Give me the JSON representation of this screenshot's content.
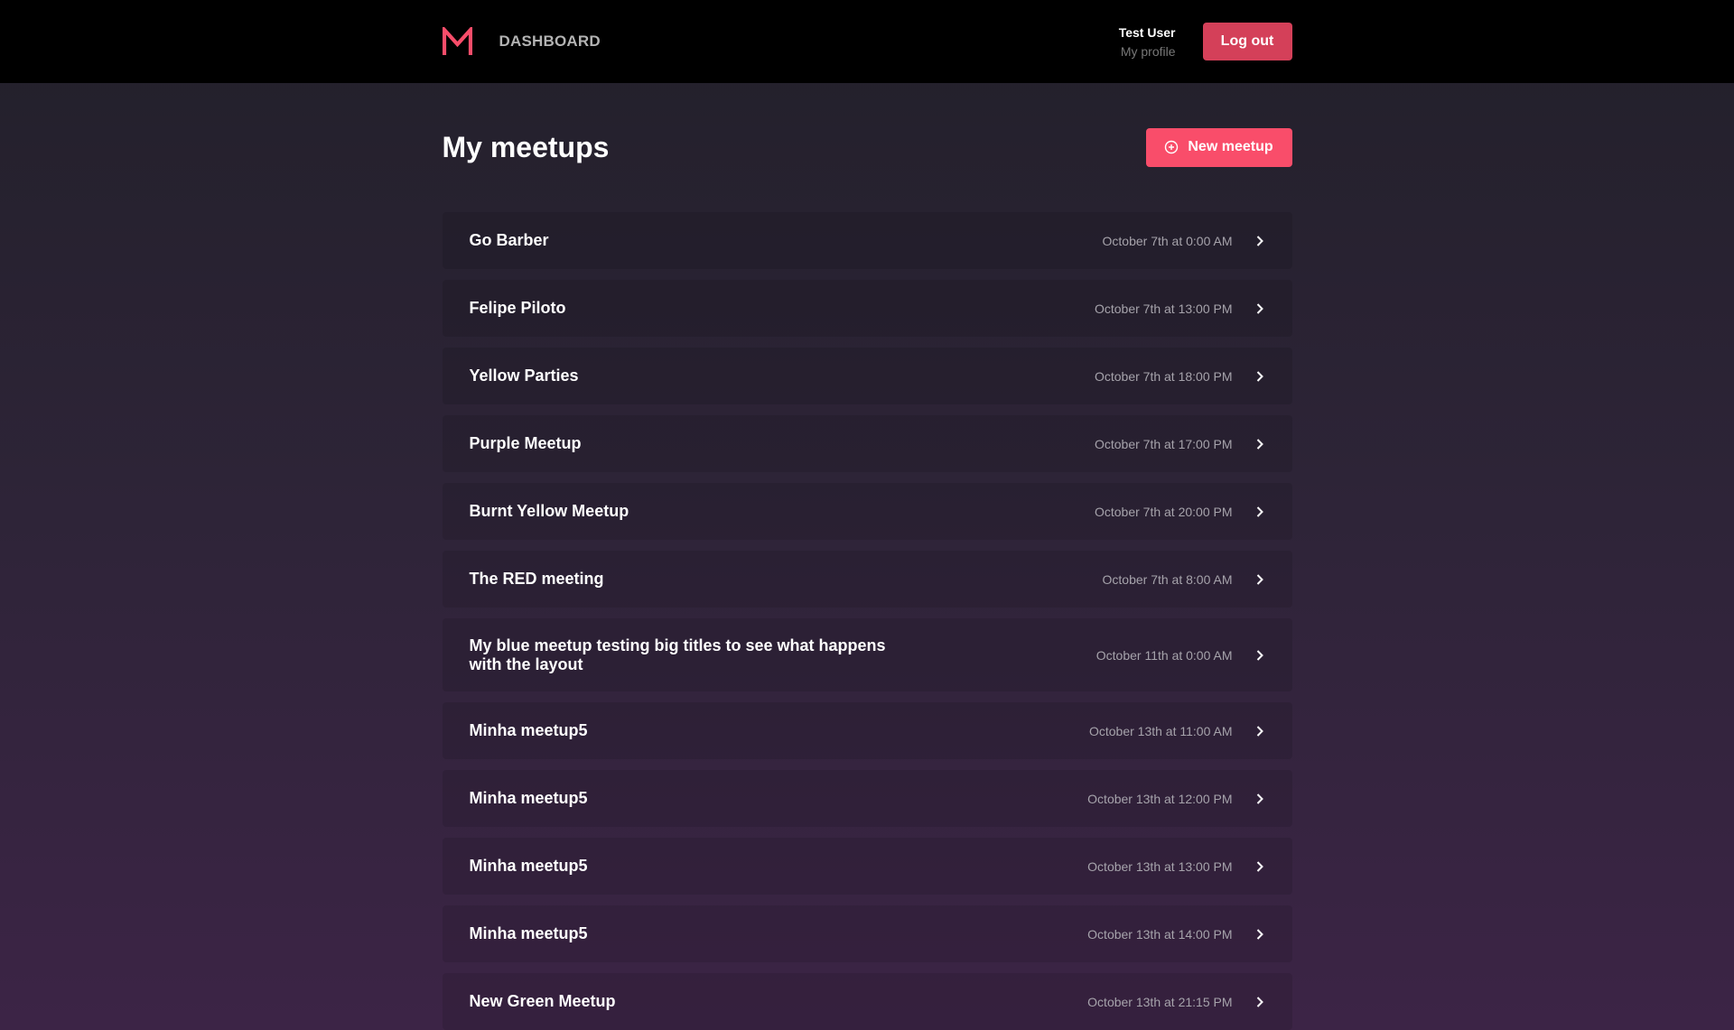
{
  "header": {
    "logo": "M",
    "nav_title": "DASHBOARD",
    "user_name": "Test User",
    "profile_link": "My profile",
    "logout_label": "Log out"
  },
  "main": {
    "title": "My meetups",
    "new_button_label": "New meetup",
    "meetups": [
      {
        "title": "Go Barber",
        "date": "October 7th at 0:00 AM"
      },
      {
        "title": "Felipe Piloto",
        "date": "October 7th at 13:00 PM"
      },
      {
        "title": "Yellow Parties",
        "date": "October 7th at 18:00 PM"
      },
      {
        "title": "Purple Meetup",
        "date": "October 7th at 17:00 PM"
      },
      {
        "title": "Burnt Yellow Meetup",
        "date": "October 7th at 20:00 PM"
      },
      {
        "title": "The RED meeting",
        "date": "October 7th at 8:00 AM"
      },
      {
        "title": "My blue meetup testing big titles to see what happens with the layout",
        "date": "October 11th at 0:00 AM"
      },
      {
        "title": "Minha meetup5",
        "date": "October 13th at 11:00 AM"
      },
      {
        "title": "Minha meetup5",
        "date": "October 13th at 12:00 PM"
      },
      {
        "title": "Minha meetup5",
        "date": "October 13th at 13:00 PM"
      },
      {
        "title": "Minha meetup5",
        "date": "October 13th at 14:00 PM"
      },
      {
        "title": "New Green Meetup",
        "date": "October 13th at 21:15 PM"
      }
    ]
  },
  "colors": {
    "accent": "#f94d6a",
    "logout": "#d44059",
    "header_bg": "#000000"
  }
}
